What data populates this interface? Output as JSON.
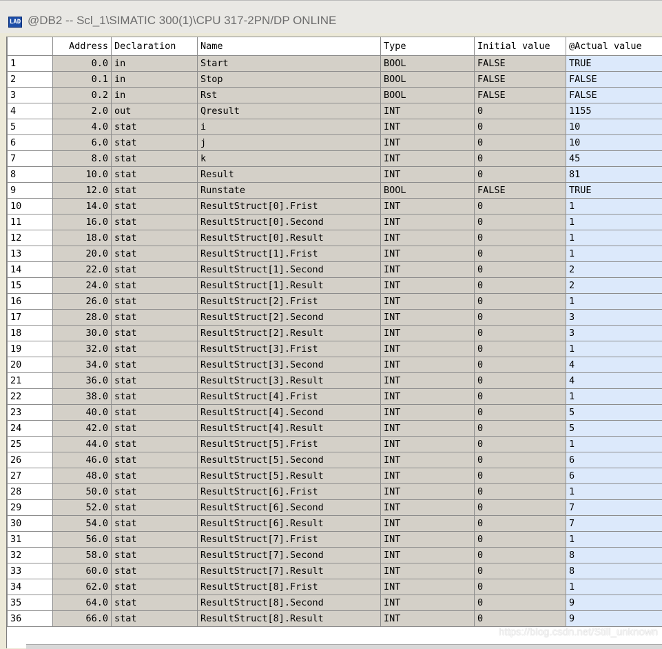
{
  "window": {
    "icon": "table-editor-icon",
    "title": "@DB2 -- Scl_1\\SIMATIC 300(1)\\CPU 317-2PN/DP  ONLINE"
  },
  "columns": [
    "",
    "Address",
    "Declaration",
    "Name",
    "Type",
    "Initial value",
    "@Actual value"
  ],
  "rows": [
    [
      "1",
      "0.0",
      "in",
      "Start",
      "BOOL",
      "FALSE",
      "TRUE"
    ],
    [
      "2",
      "0.1",
      "in",
      "Stop",
      "BOOL",
      "FALSE",
      "FALSE"
    ],
    [
      "3",
      "0.2",
      "in",
      "Rst",
      "BOOL",
      "FALSE",
      "FALSE"
    ],
    [
      "4",
      "2.0",
      "out",
      "Qresult",
      "INT",
      "0",
      "1155"
    ],
    [
      "5",
      "4.0",
      "stat",
      "i",
      "INT",
      "0",
      "10"
    ],
    [
      "6",
      "6.0",
      "stat",
      "j",
      "INT",
      "0",
      "10"
    ],
    [
      "7",
      "8.0",
      "stat",
      "k",
      "INT",
      "0",
      "45"
    ],
    [
      "8",
      "10.0",
      "stat",
      "Result",
      "INT",
      "0",
      "81"
    ],
    [
      "9",
      "12.0",
      "stat",
      "Runstate",
      "BOOL",
      "FALSE",
      "TRUE"
    ],
    [
      "10",
      "14.0",
      "stat",
      "ResultStruct[0].Frist",
      "INT",
      "0",
      "1"
    ],
    [
      "11",
      "16.0",
      "stat",
      "ResultStruct[0].Second",
      "INT",
      "0",
      "1"
    ],
    [
      "12",
      "18.0",
      "stat",
      "ResultStruct[0].Result",
      "INT",
      "0",
      "1"
    ],
    [
      "13",
      "20.0",
      "stat",
      "ResultStruct[1].Frist",
      "INT",
      "0",
      "1"
    ],
    [
      "14",
      "22.0",
      "stat",
      "ResultStruct[1].Second",
      "INT",
      "0",
      "2"
    ],
    [
      "15",
      "24.0",
      "stat",
      "ResultStruct[1].Result",
      "INT",
      "0",
      "2"
    ],
    [
      "16",
      "26.0",
      "stat",
      "ResultStruct[2].Frist",
      "INT",
      "0",
      "1"
    ],
    [
      "17",
      "28.0",
      "stat",
      "ResultStruct[2].Second",
      "INT",
      "0",
      "3"
    ],
    [
      "18",
      "30.0",
      "stat",
      "ResultStruct[2].Result",
      "INT",
      "0",
      "3"
    ],
    [
      "19",
      "32.0",
      "stat",
      "ResultStruct[3].Frist",
      "INT",
      "0",
      "1"
    ],
    [
      "20",
      "34.0",
      "stat",
      "ResultStruct[3].Second",
      "INT",
      "0",
      "4"
    ],
    [
      "21",
      "36.0",
      "stat",
      "ResultStruct[3].Result",
      "INT",
      "0",
      "4"
    ],
    [
      "22",
      "38.0",
      "stat",
      "ResultStruct[4].Frist",
      "INT",
      "0",
      "1"
    ],
    [
      "23",
      "40.0",
      "stat",
      "ResultStruct[4].Second",
      "INT",
      "0",
      "5"
    ],
    [
      "24",
      "42.0",
      "stat",
      "ResultStruct[4].Result",
      "INT",
      "0",
      "5"
    ],
    [
      "25",
      "44.0",
      "stat",
      "ResultStruct[5].Frist",
      "INT",
      "0",
      "1"
    ],
    [
      "26",
      "46.0",
      "stat",
      "ResultStruct[5].Second",
      "INT",
      "0",
      "6"
    ],
    [
      "27",
      "48.0",
      "stat",
      "ResultStruct[5].Result",
      "INT",
      "0",
      "6"
    ],
    [
      "28",
      "50.0",
      "stat",
      "ResultStruct[6].Frist",
      "INT",
      "0",
      "1"
    ],
    [
      "29",
      "52.0",
      "stat",
      "ResultStruct[6].Second",
      "INT",
      "0",
      "7"
    ],
    [
      "30",
      "54.0",
      "stat",
      "ResultStruct[6].Result",
      "INT",
      "0",
      "7"
    ],
    [
      "31",
      "56.0",
      "stat",
      "ResultStruct[7].Frist",
      "INT",
      "0",
      "1"
    ],
    [
      "32",
      "58.0",
      "stat",
      "ResultStruct[7].Second",
      "INT",
      "0",
      "8"
    ],
    [
      "33",
      "60.0",
      "stat",
      "ResultStruct[7].Result",
      "INT",
      "0",
      "8"
    ],
    [
      "34",
      "62.0",
      "stat",
      "ResultStruct[8].Frist",
      "INT",
      "0",
      "1"
    ],
    [
      "35",
      "64.0",
      "stat",
      "ResultStruct[8].Second",
      "INT",
      "0",
      "9"
    ],
    [
      "36",
      "66.0",
      "stat",
      "ResultStruct[8].Result",
      "INT",
      "0",
      "9"
    ]
  ],
  "watermark": "https://blog.csdn.net/Still_unknown",
  "colors": {
    "static_cell": "#d4d0c8",
    "actual_cell": "#dce9fb",
    "grid_line": "#8c8c8c"
  }
}
